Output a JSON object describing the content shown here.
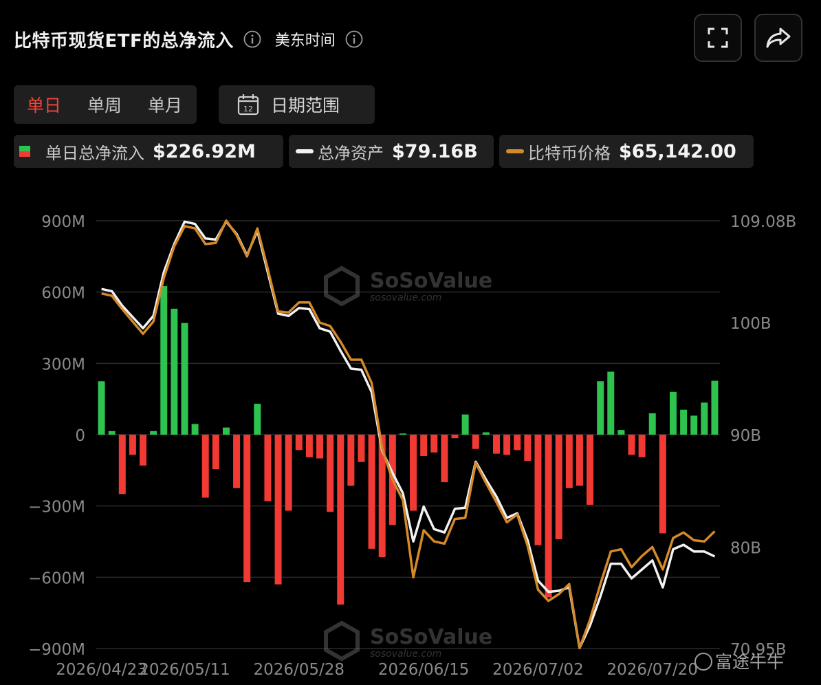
{
  "header": {
    "title": "比特币现货ETF的总净流入",
    "timezone": "美东时间"
  },
  "tabs": [
    {
      "label": "单日",
      "active": true
    },
    {
      "label": "单周",
      "active": false
    },
    {
      "label": "单月",
      "active": false
    }
  ],
  "date_range": {
    "label": "日期范围",
    "calendar_day": "12"
  },
  "legend": {
    "daily_inflow": {
      "name": "单日总净流入",
      "value": "$226.92M"
    },
    "total_assets": {
      "name": "总净资产",
      "value": "$79.16B"
    },
    "btc_price": {
      "name": "比特币价格",
      "value": "$65,142.00"
    }
  },
  "watermark": {
    "brand": "SoSoValue",
    "url": "sosovalue.com",
    "corner": "富途牛牛"
  },
  "colors": {
    "positive": "#2ec24f",
    "negative": "#f23a35",
    "assets_line": "#f2f2f2",
    "price_line": "#d4892a",
    "active_tab": "#f0463c",
    "grid": "#2a2a2a"
  },
  "chart_data": {
    "type": "bar",
    "x_tick_labels": [
      "2026/04/23",
      "2026/05/11",
      "2026/05/28",
      "2026/06/15",
      "2026/07/02",
      "2026/07/20"
    ],
    "x_tick_index": [
      0,
      8,
      19,
      31,
      42,
      53
    ],
    "y_left": {
      "ticks": [
        "900M",
        "600M",
        "300M",
        "0",
        "−300M",
        "−600M",
        "−900M"
      ],
      "range": [
        -900,
        900
      ],
      "unit": "M USD"
    },
    "y_right": {
      "ticks": [
        "109.08B",
        "100B",
        "90B",
        "80B",
        "70.95B"
      ],
      "tick_values": [
        109.08,
        100,
        90,
        80,
        70.95
      ],
      "range": [
        70.95,
        109.08
      ],
      "unit": "B USD"
    },
    "series": [
      {
        "name": "单日总净流入",
        "kind": "bar",
        "axis": "left",
        "values": [
          225,
          15,
          -250,
          -85,
          -130,
          15,
          625,
          530,
          470,
          45,
          -265,
          -145,
          30,
          -225,
          -620,
          130,
          -280,
          -630,
          -320,
          -65,
          -95,
          -100,
          -325,
          -715,
          -215,
          -115,
          -480,
          -515,
          -380,
          5,
          -320,
          -90,
          -75,
          -200,
          -15,
          85,
          -60,
          10,
          -80,
          -85,
          -65,
          -110,
          -465,
          -685,
          -440,
          -225,
          -215,
          -295,
          225,
          265,
          20,
          -85,
          -95,
          90,
          -415,
          180,
          105,
          80,
          135,
          226.92
        ]
      },
      {
        "name": "总净资产",
        "kind": "line",
        "axis": "right",
        "values": [
          103.0,
          102.8,
          101.5,
          100.5,
          99.5,
          100.6,
          104.5,
          107.0,
          109.0,
          108.8,
          107.5,
          107.4,
          109.0,
          107.9,
          106.0,
          108.2,
          104.5,
          100.8,
          100.6,
          101.3,
          101.2,
          99.5,
          99.2,
          97.5,
          95.9,
          95.8,
          93.8,
          88.6,
          86.6,
          84.8,
          80.5,
          83.6,
          81.6,
          81.3,
          83.4,
          83.5,
          87.6,
          86.0,
          84.5,
          82.6,
          83.0,
          80.6,
          77.0,
          76.0,
          76.1,
          76.4,
          71.0,
          73.0,
          75.6,
          78.5,
          78.5,
          77.2,
          78.0,
          78.8,
          76.4,
          79.8,
          80.2,
          79.6,
          79.6,
          79.16
        ]
      },
      {
        "name": "比特币价格",
        "kind": "line",
        "axis": "right",
        "values": [
          102.6,
          102.4,
          101.2,
          100.1,
          99.0,
          100.1,
          104.0,
          106.8,
          108.6,
          108.4,
          107.0,
          107.1,
          109.1,
          107.8,
          105.9,
          108.4,
          104.8,
          101.0,
          100.9,
          101.8,
          101.8,
          100.0,
          99.7,
          98.3,
          96.7,
          96.7,
          94.6,
          88.8,
          86.0,
          84.2,
          77.3,
          81.5,
          80.5,
          80.3,
          82.5,
          82.6,
          87.5,
          85.7,
          84.0,
          82.2,
          82.9,
          80.1,
          76.2,
          75.2,
          75.8,
          76.7,
          71.0,
          73.5,
          76.7,
          79.6,
          79.8,
          78.2,
          79.2,
          80.0,
          78.0,
          80.8,
          81.3,
          80.6,
          80.5,
          81.4
        ]
      }
    ]
  }
}
